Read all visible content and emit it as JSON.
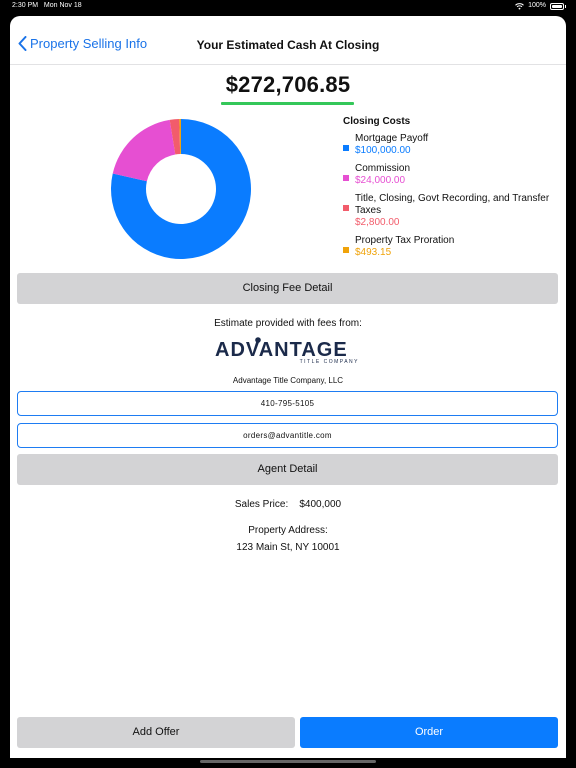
{
  "status": {
    "time": "2:30 PM",
    "date": "Mon Nov 18",
    "battery": "100%"
  },
  "nav": {
    "back_label": "Property Selling Info",
    "title": "Your Estimated Cash At Closing"
  },
  "summary": {
    "amount": "$272,706.85"
  },
  "legend": {
    "title": "Closing Costs",
    "items": [
      {
        "label": "Mortgage Payoff",
        "value": "$100,000.00",
        "color": "#0a7cff"
      },
      {
        "label": "Commission",
        "value": "$24,000.00",
        "color": "#e64fd2"
      },
      {
        "label": "Title, Closing, Govt Recording, and Transfer Taxes",
        "value": "$2,800.00",
        "color": "#f25c6b"
      },
      {
        "label": "Property Tax Proration",
        "value": "$493.15",
        "color": "#f0a30a"
      }
    ]
  },
  "chart_data": {
    "type": "pie",
    "title": "Closing Costs",
    "categories": [
      "Mortgage Payoff",
      "Commission",
      "Title, Closing, Govt Recording, and Transfer Taxes",
      "Property Tax Proration"
    ],
    "values": [
      100000.0,
      24000.0,
      2800.0,
      493.15
    ],
    "colors": [
      "#0a7cff",
      "#e64fd2",
      "#f25c6b",
      "#f0a30a"
    ],
    "donut": true
  },
  "buttons": {
    "closing_fee_detail": "Closing Fee Detail",
    "agent_detail": "Agent Detail",
    "add_offer": "Add Offer",
    "order": "Order"
  },
  "provider": {
    "caption": "Estimate provided with fees from:",
    "logo_text": "ADVANTAGE",
    "logo_subtext": "TITLE COMPANY",
    "name": "Advantage Title Company, LLC",
    "phone": "410-795-5105",
    "email": "orders@advantitle.com"
  },
  "property": {
    "sales_price_label": "Sales Price:",
    "sales_price": "$400,000",
    "address_label": "Property Address:",
    "address": "123 Main St, NY 10001"
  }
}
